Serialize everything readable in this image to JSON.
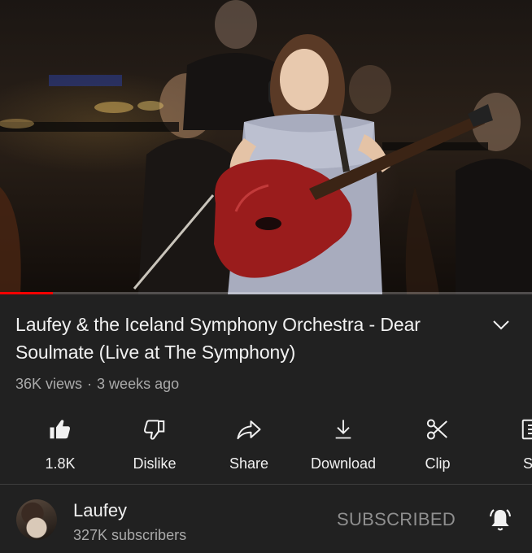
{
  "video": {
    "progress_fraction": 0.1
  },
  "title": "Laufey & the Iceland Symphony Orchestra - Dear Soulmate (Live at The Symphony)",
  "meta": {
    "views": "36K views",
    "separator": "·",
    "age": "3 weeks ago"
  },
  "actions": [
    {
      "label": "1.8K",
      "icon": "thumbs-up-filled-icon"
    },
    {
      "label": "Dislike",
      "icon": "thumbs-down-icon"
    },
    {
      "label": "Share",
      "icon": "share-arrow-icon"
    },
    {
      "label": "Download",
      "icon": "download-icon"
    },
    {
      "label": "Clip",
      "icon": "scissors-icon"
    },
    {
      "label": "Sa",
      "icon": "save-playlist-icon"
    }
  ],
  "channel": {
    "name": "Laufey",
    "subscribers": "327K subscribers",
    "subscribe_label": "SUBSCRIBED",
    "bell_icon": "notification-bell-icon"
  },
  "colors": {
    "background": "#212121",
    "text_primary": "#f1f1f1",
    "text_secondary": "#aaaaaa",
    "progress": "#ff0000"
  }
}
